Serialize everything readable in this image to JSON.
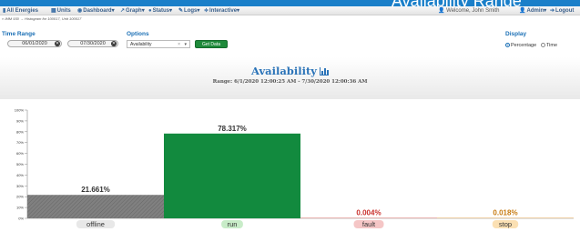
{
  "top_strip_text": "Availability Range",
  "nav": {
    "brand": "All Energies",
    "units": "Units",
    "dashboard": "Dashboard",
    "graph": "Graph",
    "status": "Status",
    "logs": "Logs",
    "interactive": "Interactive",
    "welcome": "Welcome, John Smith",
    "admin": "Admin",
    "logout": "Logout"
  },
  "breadcrumb": "» IMM 930 → Histogram for 100017, Unit 100017",
  "controls": {
    "time_range_title": "Time Range",
    "start_date": "06/01/2020",
    "end_date": "07/30/2020",
    "options_title": "Options",
    "option_selected": "Availability",
    "get_data_label": "Get Data",
    "display_title": "Display",
    "display_options": [
      "Percentage",
      "Time"
    ],
    "display_selected": "Percentage"
  },
  "chart_data": {
    "type": "bar",
    "title": "Availability",
    "subtitle": "Range: 6/1/2020 12:00:25 AM - 7/30/2020 12:00:36 AM",
    "categories": [
      "offline",
      "run",
      "fault",
      "stop"
    ],
    "values": [
      21.661,
      78.317,
      0.004,
      0.018
    ],
    "value_labels": [
      "21.661%",
      "78.317%",
      "0.004%",
      "0.018%"
    ],
    "bar_colors": [
      "#7a7a7a",
      "#128a3e",
      "#d9534f",
      "#e69a2e"
    ],
    "label_colors": [
      "#333333",
      "#333333",
      "#c9302c",
      "#c77a10"
    ],
    "category_bg": [
      "#e8e8e8",
      "#c8ecc8",
      "#f5c6c6",
      "#fbe0b3"
    ],
    "ylim": [
      0,
      100
    ],
    "yticks": [
      "0%",
      "10%",
      "20%",
      "30%",
      "40%",
      "50%",
      "60%",
      "70%",
      "80%",
      "90%",
      "100%"
    ],
    "grid": false
  }
}
